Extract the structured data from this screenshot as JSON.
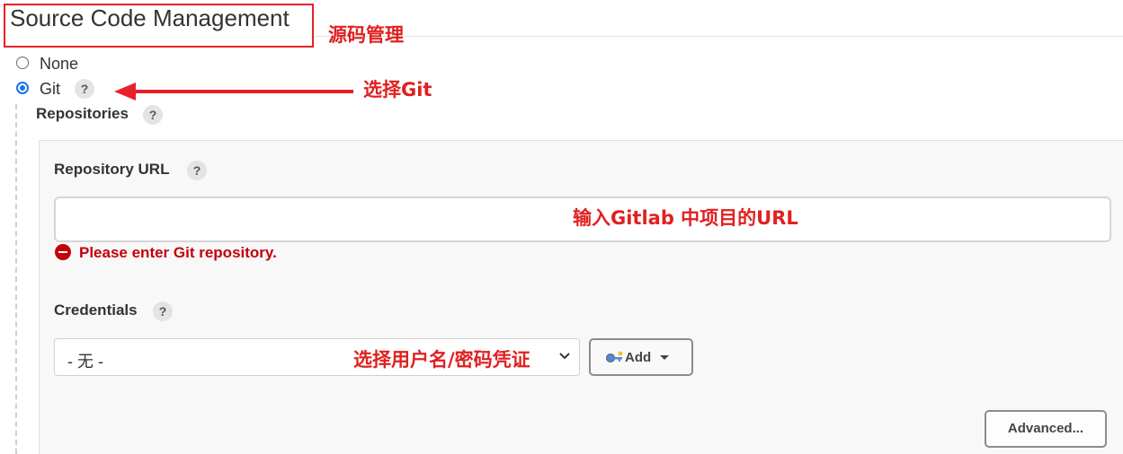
{
  "scm": {
    "title": "Source Code Management",
    "options": [
      {
        "label": "None",
        "selected": false
      },
      {
        "label": "Git",
        "selected": true
      }
    ],
    "help_glyph": "?"
  },
  "git": {
    "repositories_label": "Repositories",
    "repository_url": {
      "label": "Repository URL",
      "value": "",
      "error": "Please enter Git repository."
    },
    "credentials": {
      "label": "Credentials",
      "selected": "- 无 -",
      "add_label": "Add"
    },
    "advanced_label": "Advanced..."
  },
  "annotations": {
    "scm_note": "源码管理",
    "git_note": "选择Git",
    "url_note": "输入Gitlab 中项目的URL",
    "credentials_note": "选择用户名/密码凭证"
  },
  "colors": {
    "annotation": "#e02020",
    "error": "#c4000a",
    "radio_selected": "#1a73e8"
  },
  "icons": [
    "help-icon",
    "error-icon",
    "chevron-down-icon",
    "key-icon",
    "caret-down-icon",
    "arrow-left-icon"
  ]
}
